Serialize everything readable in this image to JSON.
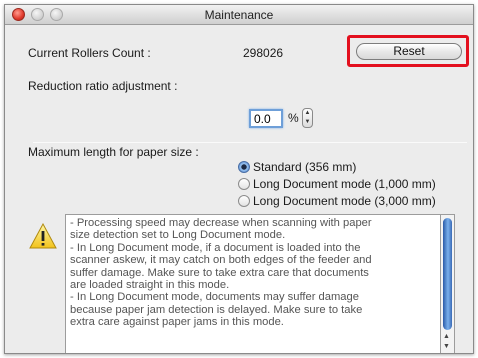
{
  "window": {
    "title": "Maintenance"
  },
  "rollers": {
    "label": "Current Rollers Count :",
    "value": "298026",
    "reset_label": "Reset"
  },
  "reduction": {
    "label": "Reduction ratio adjustment :",
    "value": "0.0",
    "unit": "%"
  },
  "paper": {
    "label": "Maximum length for paper size :",
    "options": [
      {
        "label": "Standard (356 mm)",
        "selected": true
      },
      {
        "label": "Long Document mode (1,000 mm)",
        "selected": false
      },
      {
        "label": "Long Document mode (3,000 mm)",
        "selected": false
      }
    ]
  },
  "warning": {
    "icon": "warning-icon",
    "lines": [
      "- Processing speed may decrease when scanning with paper",
      "size detection set to Long Document mode.",
      "- In Long Document mode, if a document is loaded into the",
      "scanner askew, it may catch on both edges of the feeder and",
      "suffer damage. Make sure to take extra care that documents",
      "are loaded straight in this mode.",
      "- In Long Document mode, documents may suffer damage",
      "because paper jam detection is delayed. Make sure to take",
      "extra care against paper jams in this mode."
    ]
  },
  "colors": {
    "highlight": "#e3101e",
    "focus": "#6e9fd8"
  }
}
